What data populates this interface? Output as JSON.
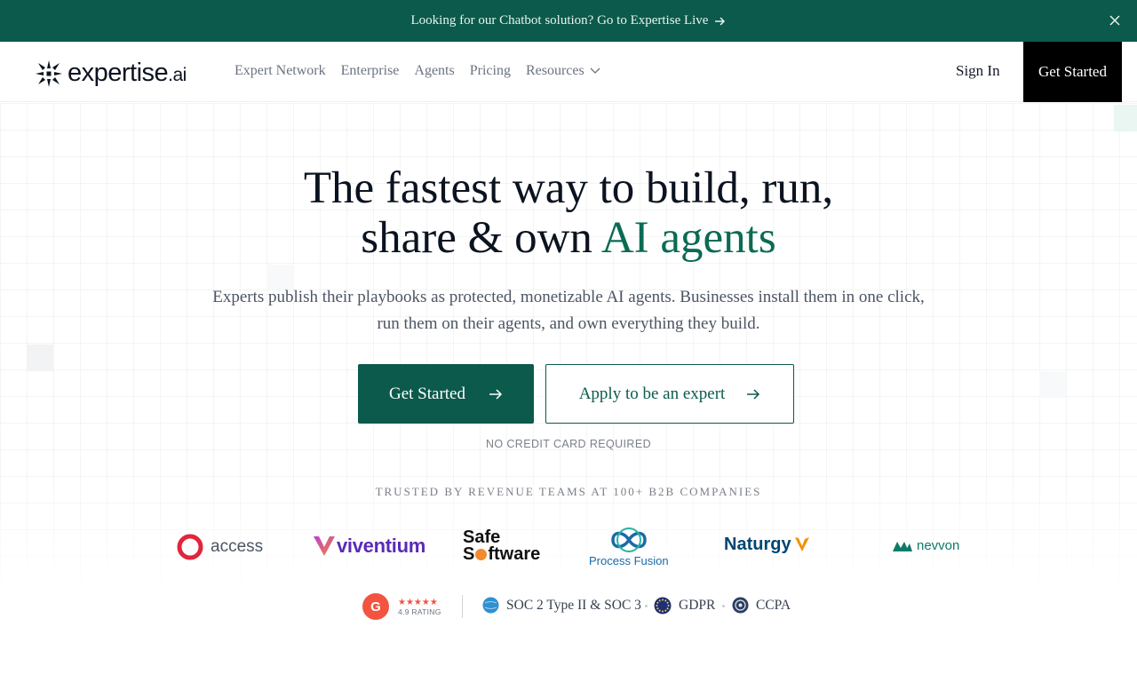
{
  "announcement": {
    "text": "Looking for our Chatbot solution? Go to Expertise Live",
    "arrow_icon": "arrow-right-icon",
    "close_icon": "close-icon"
  },
  "nav": {
    "brand": "expertise",
    "brand_suffix": ".ai",
    "items": [
      {
        "label": "Expert Network"
      },
      {
        "label": "Enterprise"
      },
      {
        "label": "Agents"
      },
      {
        "label": "Pricing"
      },
      {
        "label": "Resources",
        "icon": "chevron-down-icon"
      }
    ],
    "sign_in": "Sign In",
    "cta": "Get Started"
  },
  "hero": {
    "headline_line1": "The fastest way to build, run,",
    "headline_line2_prefix": "share & own ",
    "headline_line2_accent": "AI agents",
    "subtitle_line1": "Experts publish their playbooks as protected, monetizable AI agents. Businesses install them in one click,",
    "subtitle_line2": "run them on their agents, and own everything they build.",
    "primary_cta": "Get Started",
    "secondary_cta": "Apply to be an expert",
    "note": "NO CREDIT CARD REQUIRED"
  },
  "trusted": {
    "label": "TRUSTED BY REVENUE TEAMS AT 100+ B2B COMPANIES",
    "logos": [
      {
        "name": "access",
        "color": "#e0263c"
      },
      {
        "name": "viventium",
        "color": "#5b2bb5"
      },
      {
        "name_line1": "Safe",
        "name_line2_pre": "S",
        "name_line2_rest": "ftware"
      },
      {
        "name": "Process Fusion",
        "color": "#1a6aa8"
      },
      {
        "name": "Naturgy",
        "color": "#004571",
        "mark_color": "#f29100"
      },
      {
        "name": "nevvon",
        "color": "#0f7a6a"
      }
    ]
  },
  "badges": {
    "g2_letter": "G",
    "stars": "★★★★★",
    "rating": "4.9 RATING",
    "certs": [
      {
        "label": "SOC 2 Type II & SOC 3",
        "icon": "soc-globe-icon"
      },
      {
        "label": "GDPR",
        "icon": "eu-stars-icon"
      },
      {
        "label": "CCPA",
        "icon": "ccpa-seal-icon"
      }
    ]
  },
  "colors": {
    "brand_green": "#0b5a4b",
    "accent_green": "#0b6b55",
    "black": "#000000",
    "g2_red": "#f2543f"
  }
}
